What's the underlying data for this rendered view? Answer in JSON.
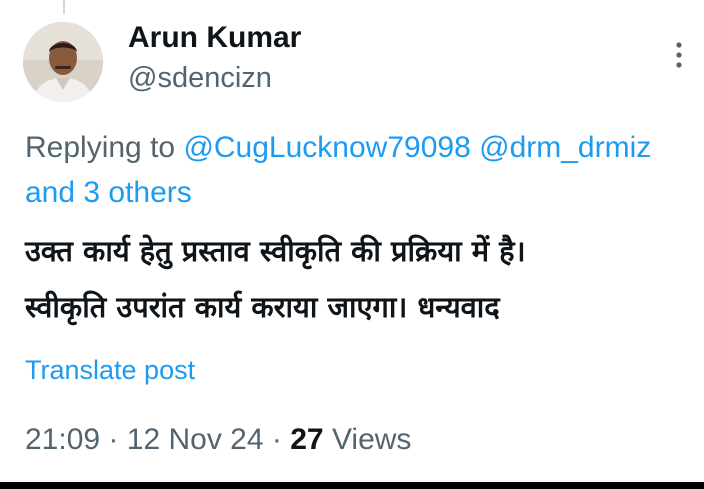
{
  "author": {
    "display_name": "Arun Kumar",
    "handle": "@sdencizn",
    "avatar_icon": "user-avatar-photo"
  },
  "more_menu": {
    "icon": "more-vertical-icon"
  },
  "reply_context": {
    "prefix": "Replying to",
    "mentions": [
      "@CugLucknow79098",
      "@drm_drmiz"
    ],
    "others": "and 3 others"
  },
  "post": {
    "lines": [
      "उक्त कार्य हेतु प्रस्ताव स्वीकृति की प्रक्रिया में है।",
      "स्वीकृति उपरांत कार्य कराया जाएगा। धन्यवाद"
    ],
    "translate_label": "Translate post"
  },
  "meta": {
    "time": "21:09",
    "date": "12 Nov 24",
    "views_count": "27",
    "views_label": "Views",
    "separator": "·"
  },
  "colors": {
    "link": "#1d9bf0",
    "secondary_text": "#536471",
    "primary_text": "#0f1419",
    "background": "#ffffff"
  }
}
